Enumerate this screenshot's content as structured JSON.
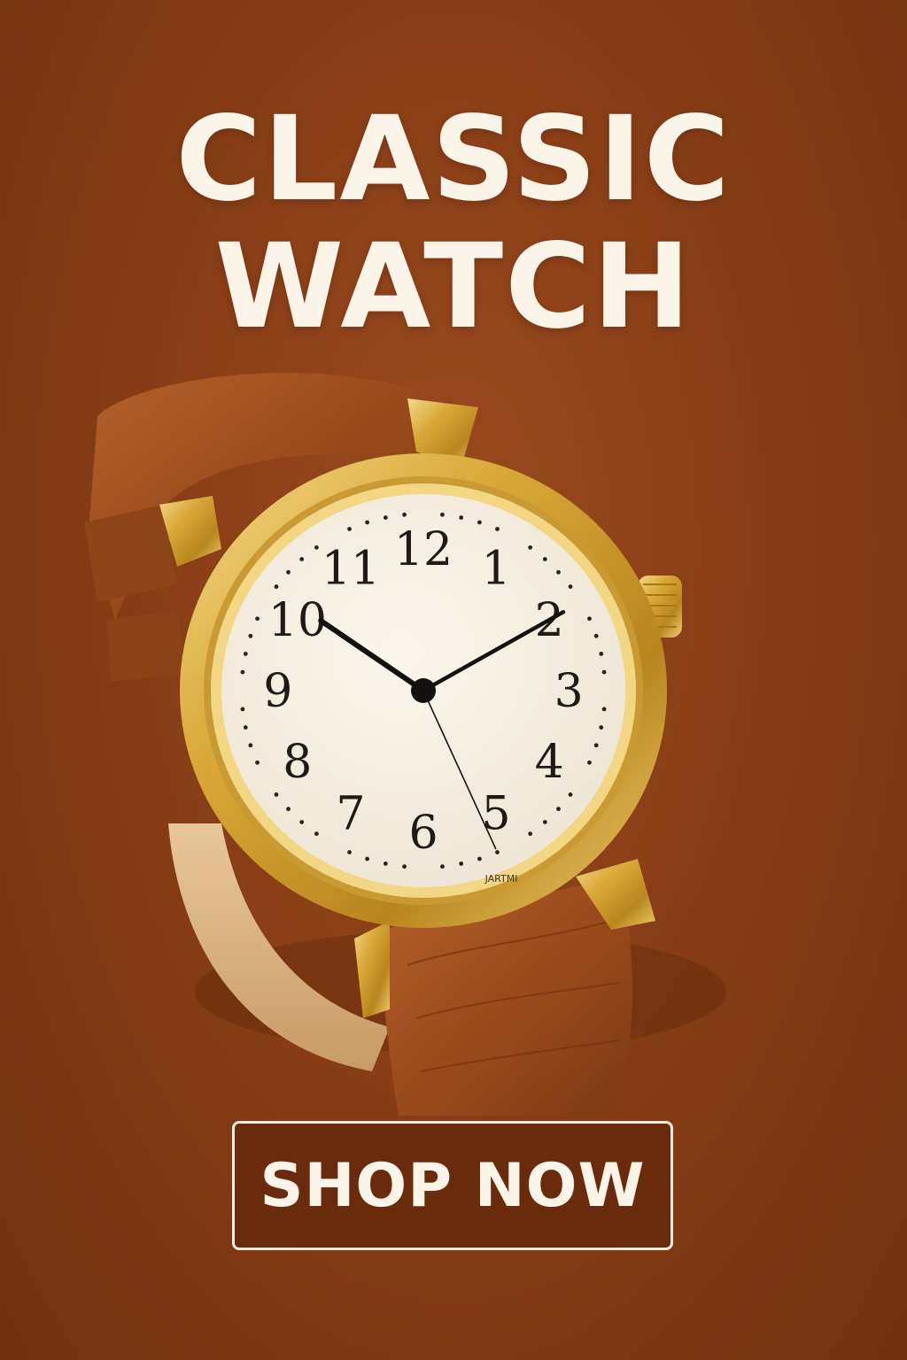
{
  "headline": {
    "line1": "CLASSIC",
    "line2": "WATCH"
  },
  "watch": {
    "dial_numerals": [
      "12",
      "1",
      "2",
      "3",
      "4",
      "5",
      "6",
      "7",
      "8",
      "9",
      "10",
      "11"
    ],
    "brand_mark": "JARTMI",
    "time_shown": {
      "hour": 10,
      "minute": 10,
      "second": 26
    }
  },
  "cta": {
    "label": "SHOP NOW"
  },
  "colors": {
    "background": "#8a3f17",
    "headline_text": "#fbf4e9",
    "strap_leather": "#a0501e",
    "case_gold": "#d9a838",
    "dial": "#f5efe2",
    "button_fill": "#6a2b0c",
    "button_border": "#f6ece0"
  }
}
